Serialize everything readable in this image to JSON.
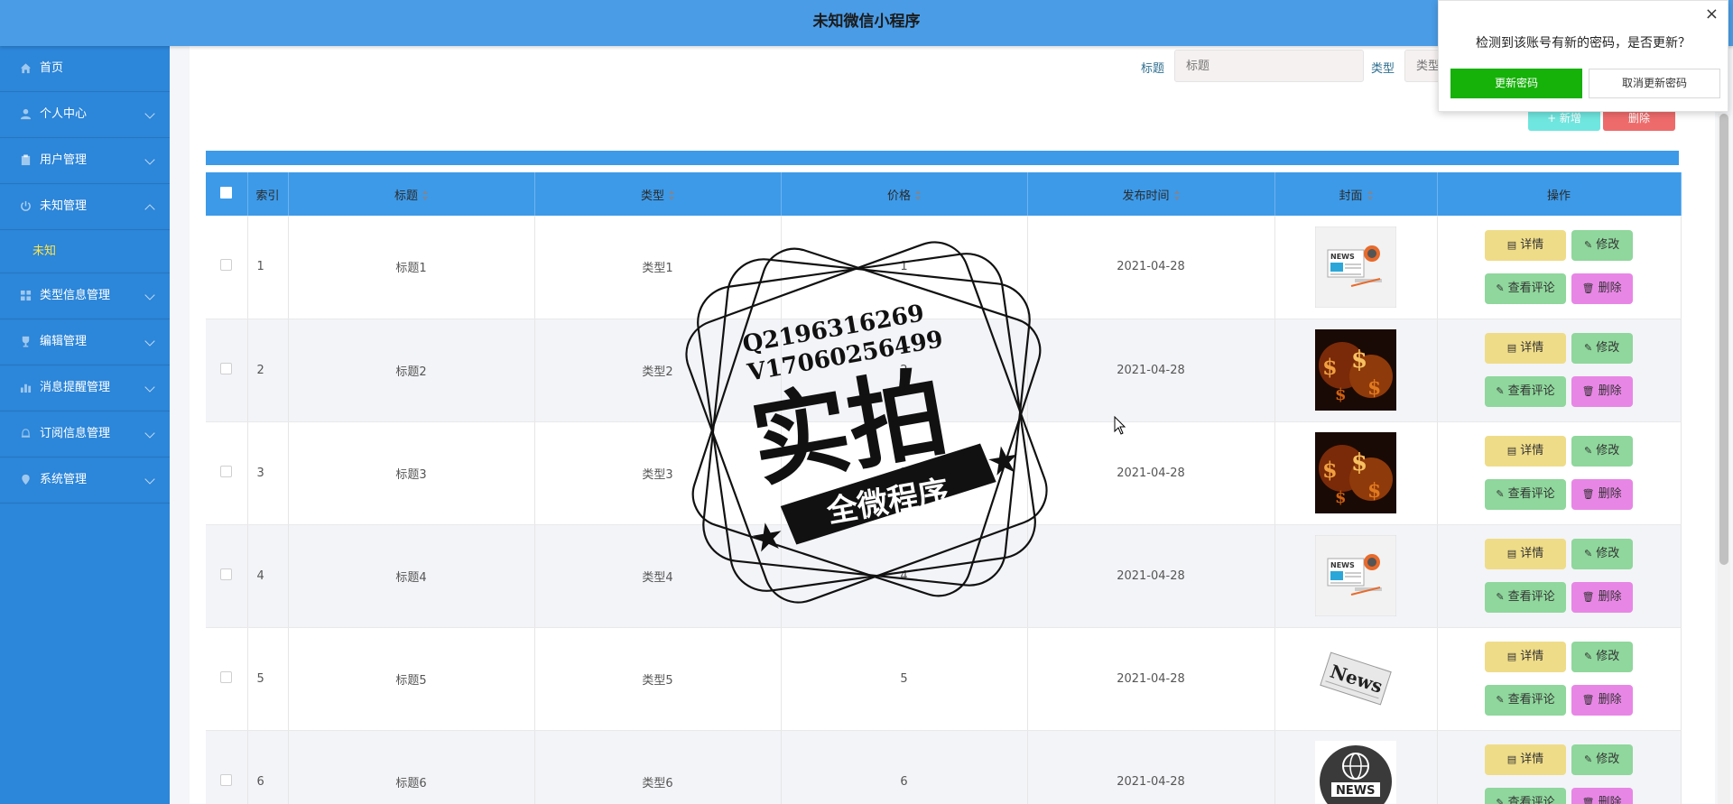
{
  "app": {
    "title": "未知微信小程序"
  },
  "sidebar": {
    "items": [
      {
        "label": "首页",
        "icon": "home-icon",
        "expandable": false
      },
      {
        "label": "个人中心",
        "icon": "user-icon",
        "expandable": true
      },
      {
        "label": "用户管理",
        "icon": "clipboard-icon",
        "expandable": true
      },
      {
        "label": "未知管理",
        "icon": "power-icon",
        "expandable": true,
        "expanded": true
      },
      {
        "label": "类型信息管理",
        "icon": "grid-icon",
        "expandable": true
      },
      {
        "label": "编辑管理",
        "icon": "trophy-icon",
        "expandable": true
      },
      {
        "label": "消息提醒管理",
        "icon": "bar-chart-icon",
        "expandable": true
      },
      {
        "label": "订阅信息管理",
        "icon": "bell-icon",
        "expandable": true
      },
      {
        "label": "系统管理",
        "icon": "pin-icon",
        "expandable": true
      }
    ],
    "active_sub": {
      "label": "未知"
    }
  },
  "search": {
    "title_label": "标题",
    "title_placeholder": "标题",
    "type_label": "类型",
    "type_placeholder": "类型"
  },
  "toolbar": {
    "add_label": "+ 新增",
    "delete_label": "删除"
  },
  "table": {
    "columns": {
      "index": "索引",
      "title": "标题",
      "type": "类型",
      "price": "价格",
      "date": "发布时间",
      "cover": "封面",
      "actions": "操作"
    },
    "rows": [
      {
        "index": "1",
        "title": "标题1",
        "type": "类型1",
        "price": "1",
        "date": "2021-04-28",
        "cover": "news-laptop-icon"
      },
      {
        "index": "2",
        "title": "标题2",
        "type": "类型2",
        "price": "2",
        "date": "2021-04-28",
        "cover": "money-fire-image"
      },
      {
        "index": "3",
        "title": "标题3",
        "type": "类型3",
        "price": "3",
        "date": "2021-04-28",
        "cover": "money-fire-image"
      },
      {
        "index": "4",
        "title": "标题4",
        "type": "类型4",
        "price": "4",
        "date": "2021-04-28",
        "cover": "news-laptop-icon"
      },
      {
        "index": "5",
        "title": "标题5",
        "type": "类型5",
        "price": "5",
        "date": "2021-04-28",
        "cover": "newspaper-image"
      },
      {
        "index": "6",
        "title": "标题6",
        "type": "类型6",
        "price": "6",
        "date": "2021-04-28",
        "cover": "news-globe-icon"
      }
    ],
    "row_actions": {
      "detail": "详情",
      "edit": "修改",
      "comment": "查看评论",
      "delete": "删除"
    }
  },
  "dialog": {
    "message": "检测到该账号有新的密码，是否更新？",
    "confirm": "更新密码",
    "cancel": "取消更新密码",
    "close": "×"
  },
  "watermark": {
    "line1": "Q2196316269",
    "line2": "V17060256499",
    "big": "实拍",
    "ribbon": "全微程序"
  },
  "colors": {
    "header": "#4a9ce6",
    "sidebar": "#2c86d9",
    "table_header": "#3d9ae8",
    "active_sub": "#ffe44a",
    "confirm": "#16b109"
  }
}
